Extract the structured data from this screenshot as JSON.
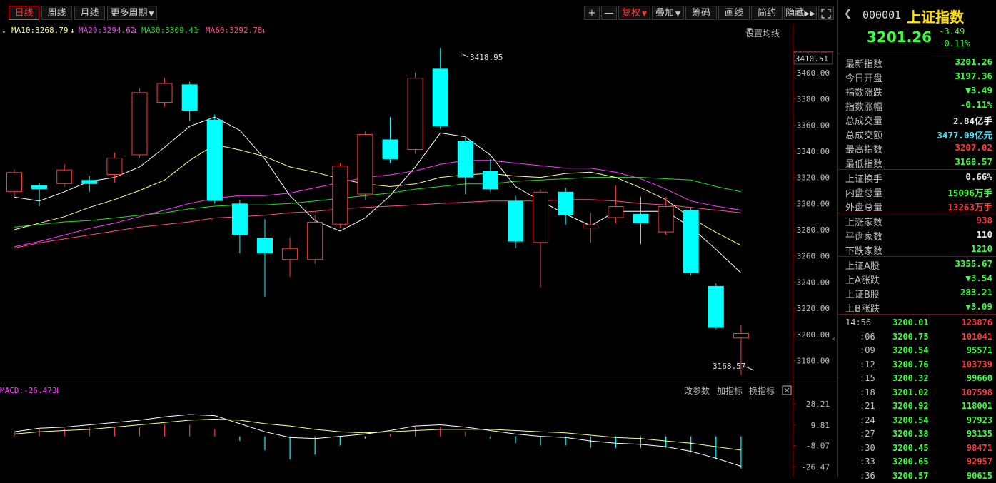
{
  "toolbar": {
    "tabs": [
      "日线",
      "周线",
      "月线",
      "更多周期"
    ],
    "active_tab": "日线",
    "tools": [
      "+",
      "—",
      "复权",
      "叠加",
      "筹码",
      "画线",
      "简约",
      "隐藏"
    ],
    "more_icon": "caret-down-icon",
    "expand_icon": "fullscreen-icon"
  },
  "ma_legend": {
    "ma10": "MA10:3268.79",
    "ma20": "MA20:3294.62",
    "ma30": "MA30:3309.41",
    "ma60": "MA60:3292.78",
    "settings": "设置均线"
  },
  "colors": {
    "up": "#ff3a3a",
    "down": "#00ffff",
    "ma5": "#ffffff",
    "ma10": "#ffff8c",
    "ma20": "#ff3aff",
    "ma30": "#22dd22",
    "ma60": "#ff4a8a",
    "green_text": "#3cff3c",
    "red_text": "#ff3a3a",
    "accent_yellow": "#ffe000"
  },
  "chart_data": [
    {
      "type": "candlestick",
      "ylim": [
        3165,
        3425
      ],
      "y_ticks": [
        3180,
        3200,
        3220,
        3240,
        3260,
        3280,
        3300,
        3320,
        3340,
        3360,
        3380,
        3400
      ],
      "y_tick_labels": [
        "3180.00",
        "3200.00",
        "3220.00",
        "3240.00",
        "3260.00",
        "3280.00",
        "3300.00",
        "3320.00",
        "3340.00",
        "3360.00",
        "3380.00",
        "3400.00"
      ],
      "top_label": "3410.51",
      "high_annotation": "3418.95",
      "low_annotation": "3168.57",
      "candles": [
        {
          "o": 3309,
          "c": 3324,
          "h": 3326,
          "l": 3305
        },
        {
          "o": 3314,
          "c": 3311,
          "h": 3316,
          "l": 3298
        },
        {
          "o": 3315,
          "c": 3326,
          "h": 3330,
          "l": 3313
        },
        {
          "o": 3318,
          "c": 3315,
          "h": 3321,
          "l": 3309
        },
        {
          "o": 3322,
          "c": 3335,
          "h": 3339,
          "l": 3316
        },
        {
          "o": 3337,
          "c": 3385,
          "h": 3388,
          "l": 3335
        },
        {
          "o": 3377,
          "c": 3392,
          "h": 3396,
          "l": 3374
        },
        {
          "o": 3391,
          "c": 3371,
          "h": 3393,
          "l": 3363
        },
        {
          "o": 3364,
          "c": 3302,
          "h": 3368,
          "l": 3300
        },
        {
          "o": 3300,
          "c": 3276,
          "h": 3303,
          "l": 3262
        },
        {
          "o": 3274,
          "c": 3262,
          "h": 3288,
          "l": 3229
        },
        {
          "o": 3257,
          "c": 3266,
          "h": 3274,
          "l": 3244
        },
        {
          "o": 3257,
          "c": 3286,
          "h": 3291,
          "l": 3254
        },
        {
          "o": 3284,
          "c": 3329,
          "h": 3331,
          "l": 3281
        },
        {
          "o": 3307,
          "c": 3353,
          "h": 3355,
          "l": 3303
        },
        {
          "o": 3349,
          "c": 3334,
          "h": 3366,
          "l": 3331
        },
        {
          "o": 3341,
          "c": 3396,
          "h": 3400,
          "l": 3338
        },
        {
          "o": 3403,
          "c": 3359,
          "h": 3419,
          "l": 3357
        },
        {
          "o": 3348,
          "c": 3320,
          "h": 3350,
          "l": 3307
        },
        {
          "o": 3325,
          "c": 3311,
          "h": 3334,
          "l": 3309
        },
        {
          "o": 3302,
          "c": 3271,
          "h": 3306,
          "l": 3266
        },
        {
          "o": 3270,
          "c": 3309,
          "h": 3311,
          "l": 3236
        },
        {
          "o": 3309,
          "c": 3291,
          "h": 3312,
          "l": 3284
        },
        {
          "o": 3281,
          "c": 3284,
          "h": 3293,
          "l": 3270
        },
        {
          "o": 3289,
          "c": 3298,
          "h": 3314,
          "l": 3285
        },
        {
          "o": 3292,
          "c": 3285,
          "h": 3305,
          "l": 3269
        },
        {
          "o": 3278,
          "c": 3298,
          "h": 3305,
          "l": 3276
        },
        {
          "o": 3295,
          "c": 3247,
          "h": 3297,
          "l": 3245
        },
        {
          "o": 3237,
          "c": 3205,
          "h": 3239,
          "l": 3204
        },
        {
          "o": 3197,
          "c": 3201,
          "h": 3207,
          "l": 3169
        }
      ],
      "ma5": [
        3305,
        3302,
        3309,
        3317,
        3320,
        3328,
        3343,
        3359,
        3366,
        3356,
        3334,
        3306,
        3287,
        3279,
        3289,
        3306,
        3328,
        3354,
        3351,
        3337,
        3313,
        3302,
        3292,
        3283,
        3294,
        3294,
        3294,
        3282,
        3265,
        3247
      ],
      "ma10": [
        3280,
        3285,
        3290,
        3297,
        3303,
        3310,
        3318,
        3333,
        3345,
        3341,
        3336,
        3328,
        3324,
        3319,
        3315,
        3313,
        3315,
        3320,
        3322,
        3323,
        3321,
        3320,
        3323,
        3324,
        3320,
        3312,
        3303,
        3289,
        3278,
        3268
      ],
      "ma20": [
        3267,
        3271,
        3276,
        3281,
        3285,
        3290,
        3295,
        3300,
        3304,
        3306,
        3306,
        3308,
        3312,
        3316,
        3320,
        3322,
        3325,
        3330,
        3333,
        3333,
        3331,
        3329,
        3327,
        3327,
        3324,
        3319,
        3311,
        3302,
        3298,
        3295
      ],
      "ma30": [
        3282,
        3284,
        3286,
        3287,
        3289,
        3291,
        3293,
        3296,
        3298,
        3299,
        3299,
        3300,
        3302,
        3304,
        3306,
        3308,
        3311,
        3313,
        3315,
        3315,
        3317,
        3318,
        3319,
        3320,
        3320,
        3320,
        3319,
        3318,
        3313,
        3309
      ],
      "ma60": [
        3266,
        3270,
        3273,
        3276,
        3279,
        3282,
        3284,
        3286,
        3289,
        3290,
        3291,
        3293,
        3294,
        3296,
        3297,
        3298,
        3299,
        3300,
        3301,
        3302,
        3302,
        3302,
        3303,
        3303,
        3302,
        3300,
        3299,
        3297,
        3295,
        3293
      ]
    },
    {
      "type": "macd",
      "title": "MACD:-26.473",
      "ylim": [
        -30,
        32
      ],
      "y_ticks": [
        28.21,
        9.81,
        -8.07,
        -26.47
      ],
      "y_tick_labels": [
        "28.21",
        "9.81",
        "-8.07",
        "-26.47"
      ],
      "dif": [
        4,
        7,
        8,
        10,
        12,
        14,
        17,
        19,
        18,
        11,
        4,
        -1,
        -2,
        0,
        2,
        5,
        9,
        10,
        8,
        5,
        2,
        0,
        -1,
        -4,
        -6,
        -7,
        -9,
        -13,
        -19,
        -26
      ],
      "dea": [
        2,
        4,
        5,
        6,
        8,
        10,
        12,
        14,
        15,
        14,
        11,
        9,
        6,
        4,
        3,
        4,
        5,
        6,
        6,
        6,
        5,
        4,
        3,
        1,
        -1,
        -2,
        -4,
        -6,
        -9,
        -12
      ],
      "hist": [
        4,
        6,
        6,
        8,
        8,
        8,
        10,
        10,
        6,
        -4,
        -12,
        -20,
        -16,
        -8,
        -2,
        2,
        8,
        8,
        4,
        -2,
        -6,
        -8,
        -8,
        -10,
        -10,
        -10,
        -10,
        -14,
        -20,
        -28
      ],
      "tools": [
        "改参数",
        "加指标",
        "换指标"
      ]
    }
  ],
  "quote": {
    "code": "000001",
    "name": "上证指数",
    "price": "3201.26",
    "change": "-3.49",
    "pct": "-0.11%",
    "stats": [
      {
        "label": "最新指数",
        "value": "3201.26",
        "color": "green"
      },
      {
        "label": "今日开盘",
        "value": "3197.36",
        "color": "green"
      },
      {
        "label": "指数涨跌",
        "value": "▼3.49",
        "color": "green"
      },
      {
        "label": "指数涨幅",
        "value": "-0.11%",
        "color": "green"
      },
      {
        "label": "总成交量",
        "value": "2.84亿手",
        "color": "white"
      },
      {
        "label": "总成交额",
        "value": "3477.09亿元",
        "color": "cyan"
      },
      {
        "label": "最高指数",
        "value": "3207.02",
        "color": "red"
      },
      {
        "label": "最低指数",
        "value": "3168.57",
        "color": "green"
      }
    ],
    "stats2": [
      {
        "label": "上证换手",
        "value": "0.66%",
        "color": "white"
      },
      {
        "label": "内盘总量",
        "value": "15096万手",
        "color": "green"
      },
      {
        "label": "外盘总量",
        "value": "13263万手",
        "color": "red"
      }
    ],
    "stats3": [
      {
        "label": "上涨家数",
        "value": "938",
        "color": "red"
      },
      {
        "label": "平盘家数",
        "value": "110",
        "color": "white"
      },
      {
        "label": "下跌家数",
        "value": "1210",
        "color": "green"
      }
    ],
    "stats4": [
      {
        "label": "上证A股",
        "value": "3355.67",
        "color": "green"
      },
      {
        "label": "上A涨跌",
        "value": "▼3.54",
        "color": "green"
      },
      {
        "label": "上证B股",
        "value": "283.21",
        "color": "green"
      },
      {
        "label": "上B涨跌",
        "value": "▼3.09",
        "color": "green"
      }
    ],
    "ticks": [
      {
        "time": "14:56",
        "price": "3200.01",
        "vol": "123876",
        "vc": "red"
      },
      {
        "time": ":06",
        "price": "3200.75",
        "vol": "101041",
        "vc": "red"
      },
      {
        "time": ":09",
        "price": "3200.54",
        "vol": "95571",
        "vc": "green"
      },
      {
        "time": ":12",
        "price": "3200.76",
        "vol": "103739",
        "vc": "red"
      },
      {
        "time": ":15",
        "price": "3200.32",
        "vol": "99660",
        "vc": "green"
      },
      {
        "time": ":18",
        "price": "3201.02",
        "vol": "107598",
        "vc": "red"
      },
      {
        "time": ":21",
        "price": "3200.92",
        "vol": "118001",
        "vc": "green"
      },
      {
        "time": ":24",
        "price": "3200.54",
        "vol": "97923",
        "vc": "green"
      },
      {
        "time": ":27",
        "price": "3200.38",
        "vol": "93135",
        "vc": "green"
      },
      {
        "time": ":30",
        "price": "3200.45",
        "vol": "98471",
        "vc": "red"
      },
      {
        "time": ":33",
        "price": "3200.65",
        "vol": "92957",
        "vc": "red"
      },
      {
        "time": ":36",
        "price": "3200.57",
        "vol": "90615",
        "vc": "green"
      }
    ]
  }
}
